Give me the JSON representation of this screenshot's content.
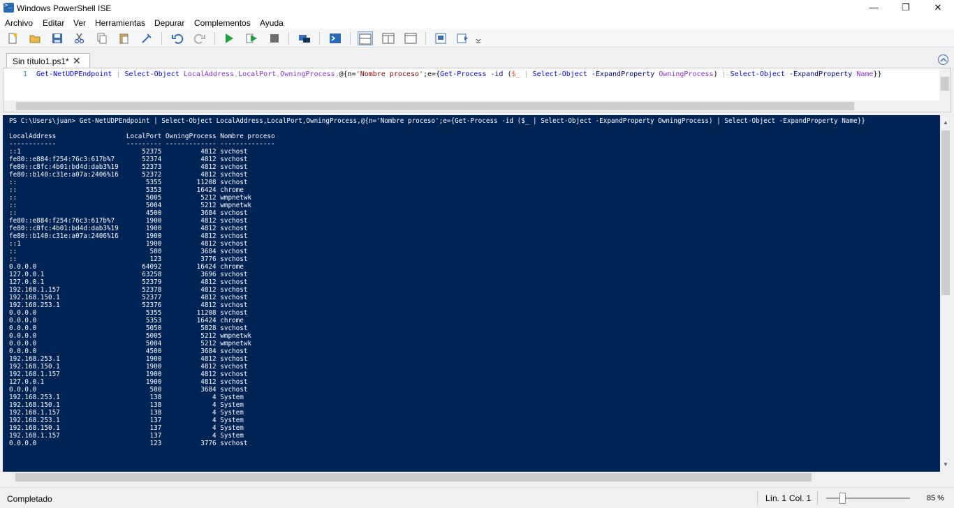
{
  "window": {
    "title": "Windows PowerShell ISE",
    "minimize": "—",
    "restore": "❐",
    "close": "✕"
  },
  "menu": [
    "Archivo",
    "Editar",
    "Ver",
    "Herramientas",
    "Depurar",
    "Complementos",
    "Ayuda"
  ],
  "tab": {
    "label": "Sin título1.ps1*",
    "close": "✕"
  },
  "script": {
    "line_number": "1",
    "tokens": [
      {
        "t": "Get-NetUDPEndpoint",
        "c": "cmd"
      },
      {
        "t": " ",
        "c": "par"
      },
      {
        "t": "|",
        "c": "op"
      },
      {
        "t": " ",
        "c": "par"
      },
      {
        "t": "Select-Object",
        "c": "cmd"
      },
      {
        "t": " ",
        "c": "par"
      },
      {
        "t": "LocalAddress",
        "c": "arg"
      },
      {
        "t": ",",
        "c": "op"
      },
      {
        "t": "LocalPort",
        "c": "arg"
      },
      {
        "t": ",",
        "c": "op"
      },
      {
        "t": "OwningProcess",
        "c": "arg"
      },
      {
        "t": ",",
        "c": "op"
      },
      {
        "t": "@{n=",
        "c": "par"
      },
      {
        "t": "'Nombre proceso'",
        "c": "str"
      },
      {
        "t": ";e={",
        "c": "par"
      },
      {
        "t": "Get-Process",
        "c": "cmd"
      },
      {
        "t": " ",
        "c": "par"
      },
      {
        "t": "-id",
        "c": "param"
      },
      {
        "t": " (",
        "c": "par"
      },
      {
        "t": "$_",
        "c": "var"
      },
      {
        "t": " ",
        "c": "par"
      },
      {
        "t": "|",
        "c": "op"
      },
      {
        "t": " ",
        "c": "par"
      },
      {
        "t": "Select-Object",
        "c": "cmd"
      },
      {
        "t": " ",
        "c": "par"
      },
      {
        "t": "-ExpandProperty",
        "c": "param"
      },
      {
        "t": " ",
        "c": "par"
      },
      {
        "t": "OwningProcess",
        "c": "arg"
      },
      {
        "t": ") ",
        "c": "par"
      },
      {
        "t": "|",
        "c": "op"
      },
      {
        "t": " ",
        "c": "par"
      },
      {
        "t": "Select-Object",
        "c": "cmd"
      },
      {
        "t": " ",
        "c": "par"
      },
      {
        "t": "-ExpandProperty",
        "c": "param"
      },
      {
        "t": " ",
        "c": "par"
      },
      {
        "t": "Name",
        "c": "arg"
      },
      {
        "t": "}}",
        "c": "par"
      }
    ]
  },
  "console": {
    "prompt": "PS C:\\Users\\juan> Get-NetUDPEndpoint | Select-Object LocalAddress,LocalPort,OwningProcess,@{n='Nombre proceso';e={Get-Process -id ($_ | Select-Object -ExpandProperty OwningProcess) | Select-Object -ExpandProperty Name}}",
    "headers": [
      "LocalAddress",
      "LocalPort",
      "OwningProcess",
      "Nombre proceso"
    ],
    "rows": [
      [
        "::1",
        "52375",
        "4812",
        "svchost"
      ],
      [
        "fe80::e884:f254:76c3:617b%7",
        "52374",
        "4812",
        "svchost"
      ],
      [
        "fe80::c8fc:4b01:bd4d:dab3%19",
        "52373",
        "4812",
        "svchost"
      ],
      [
        "fe80::b140:c31e:a07a:2406%16",
        "52372",
        "4812",
        "svchost"
      ],
      [
        "::",
        "5355",
        "11208",
        "svchost"
      ],
      [
        "::",
        "5353",
        "16424",
        "chrome"
      ],
      [
        "::",
        "5005",
        "5212",
        "wmpnetwk"
      ],
      [
        "::",
        "5004",
        "5212",
        "wmpnetwk"
      ],
      [
        "::",
        "4500",
        "3684",
        "svchost"
      ],
      [
        "fe80::e884:f254:76c3:617b%7",
        "1900",
        "4812",
        "svchost"
      ],
      [
        "fe80::c8fc:4b01:bd4d:dab3%19",
        "1900",
        "4812",
        "svchost"
      ],
      [
        "fe80::b140:c31e:a07a:2406%16",
        "1900",
        "4812",
        "svchost"
      ],
      [
        "::1",
        "1900",
        "4812",
        "svchost"
      ],
      [
        "::",
        "500",
        "3684",
        "svchost"
      ],
      [
        "::",
        "123",
        "3776",
        "svchost"
      ],
      [
        "0.0.0.0",
        "64092",
        "16424",
        "chrome"
      ],
      [
        "127.0.0.1",
        "63258",
        "3696",
        "svchost"
      ],
      [
        "127.0.0.1",
        "52379",
        "4812",
        "svchost"
      ],
      [
        "192.168.1.157",
        "52378",
        "4812",
        "svchost"
      ],
      [
        "192.168.150.1",
        "52377",
        "4812",
        "svchost"
      ],
      [
        "192.168.253.1",
        "52376",
        "4812",
        "svchost"
      ],
      [
        "0.0.0.0",
        "5355",
        "11208",
        "svchost"
      ],
      [
        "0.0.0.0",
        "5353",
        "16424",
        "chrome"
      ],
      [
        "0.0.0.0",
        "5050",
        "5828",
        "svchost"
      ],
      [
        "0.0.0.0",
        "5005",
        "5212",
        "wmpnetwk"
      ],
      [
        "0.0.0.0",
        "5004",
        "5212",
        "wmpnetwk"
      ],
      [
        "0.0.0.0",
        "4500",
        "3684",
        "svchost"
      ],
      [
        "192.168.253.1",
        "1900",
        "4812",
        "svchost"
      ],
      [
        "192.168.150.1",
        "1900",
        "4812",
        "svchost"
      ],
      [
        "192.168.1.157",
        "1900",
        "4812",
        "svchost"
      ],
      [
        "127.0.0.1",
        "1900",
        "4812",
        "svchost"
      ],
      [
        "0.0.0.0",
        "500",
        "3684",
        "svchost"
      ],
      [
        "192.168.253.1",
        "138",
        "4",
        "System"
      ],
      [
        "192.168.150.1",
        "138",
        "4",
        "System"
      ],
      [
        "192.168.1.157",
        "138",
        "4",
        "System"
      ],
      [
        "192.168.253.1",
        "137",
        "4",
        "System"
      ],
      [
        "192.168.150.1",
        "137",
        "4",
        "System"
      ],
      [
        "192.168.1.157",
        "137",
        "4",
        "System"
      ],
      [
        "0.0.0.0",
        "123",
        "3776",
        "svchost"
      ]
    ]
  },
  "status": {
    "text": "Completado",
    "line": "Lín. 1",
    "col": "Col. 1",
    "zoom": "85 %"
  },
  "colors": {
    "console_bg": "#012456",
    "cmdlet": "#0000ff",
    "argument": "#8a2be2",
    "string": "#8b0000",
    "variable": "#ff4500",
    "line_number": "#2b91af"
  }
}
